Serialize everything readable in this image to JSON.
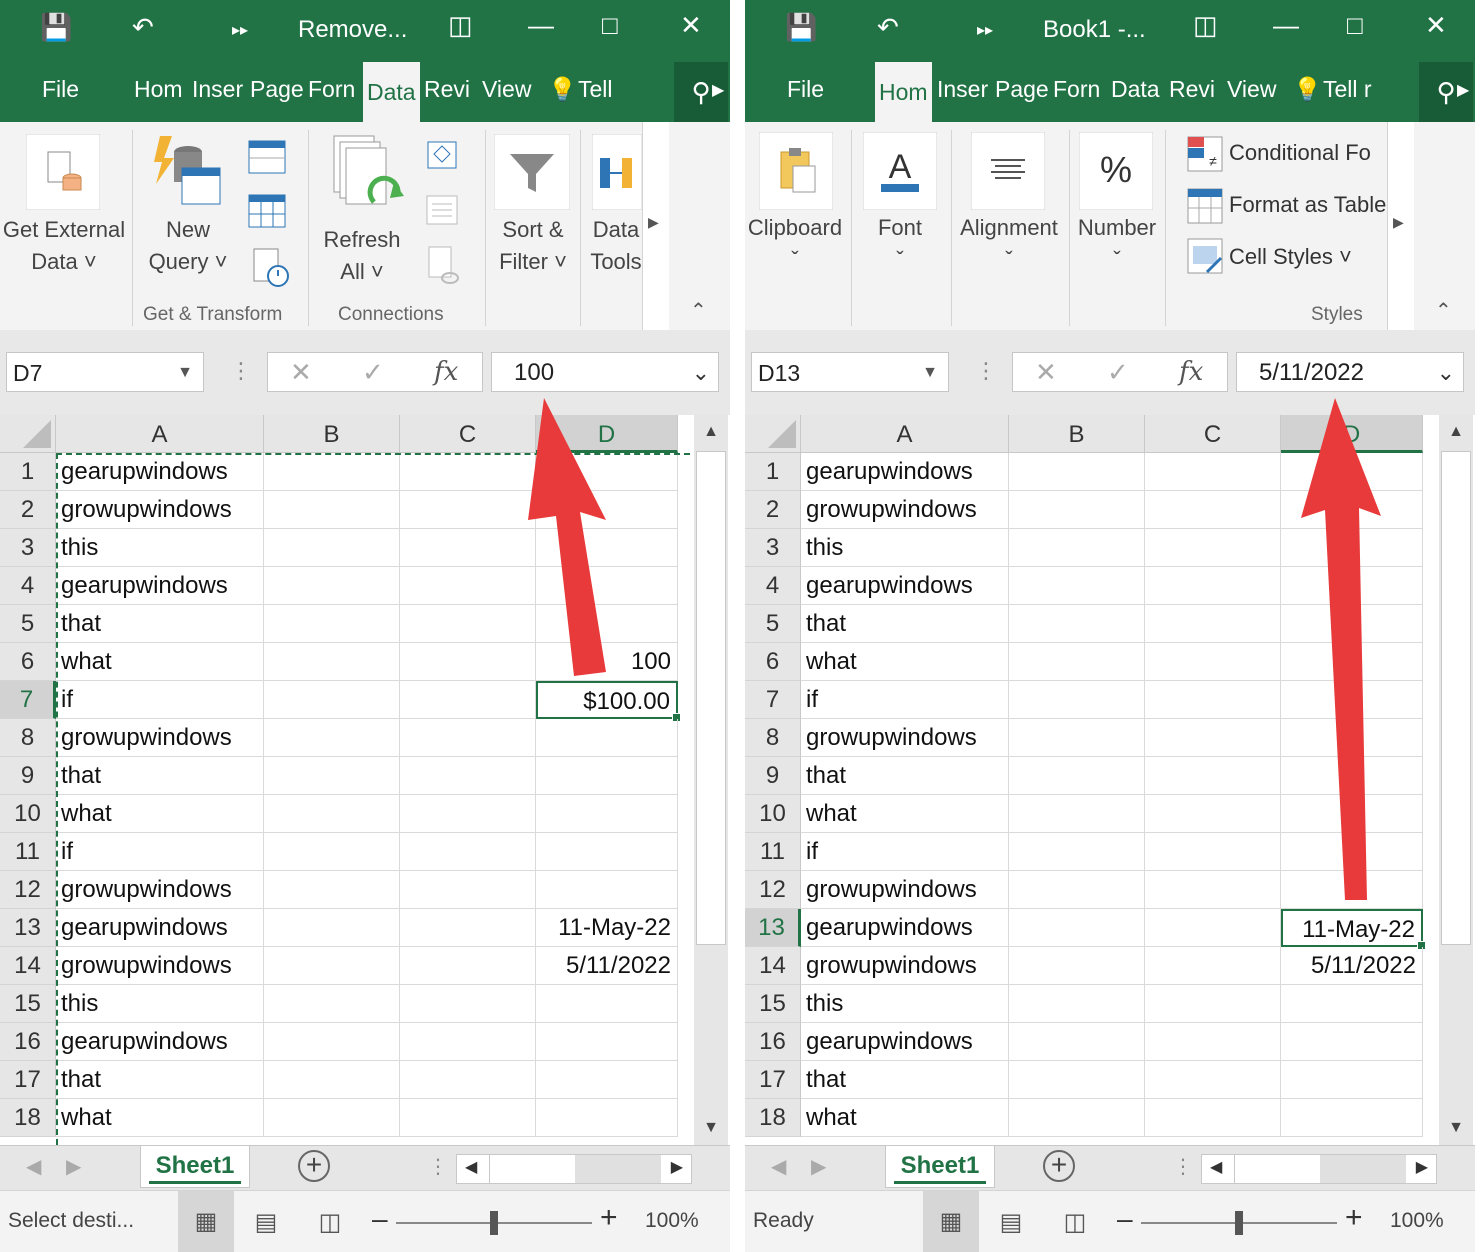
{
  "left": {
    "title": "Remove...",
    "tabs": [
      "File",
      "Hom",
      "Inser",
      "Page",
      "Forn",
      "Data",
      "Revi",
      "View",
      "Tell"
    ],
    "active_tab": "Data",
    "ribbon": {
      "get_external_data": [
        "Get External",
        "Data ˅"
      ],
      "new_query": [
        "New",
        "Query ˅"
      ],
      "refresh_all": [
        "Refresh",
        "All ˅"
      ],
      "sort_filter": [
        "Sort &",
        "Filter ˅"
      ],
      "data_tools": [
        "Data",
        "Tools"
      ],
      "group_get_transform": "Get & Transform",
      "group_connections": "Connections"
    },
    "name_box": "D7",
    "formula_value": "100",
    "columns": [
      "A",
      "B",
      "C",
      "D"
    ],
    "rows": [
      {
        "n": "1",
        "a": "gearupwindows",
        "d": ""
      },
      {
        "n": "2",
        "a": "growupwindows",
        "d": ""
      },
      {
        "n": "3",
        "a": "this",
        "d": ""
      },
      {
        "n": "4",
        "a": "gearupwindows",
        "d": ""
      },
      {
        "n": "5",
        "a": "that",
        "d": ""
      },
      {
        "n": "6",
        "a": "what",
        "d": "100"
      },
      {
        "n": "7",
        "a": "if",
        "d": "$100.00"
      },
      {
        "n": "8",
        "a": "growupwindows",
        "d": ""
      },
      {
        "n": "9",
        "a": "that",
        "d": ""
      },
      {
        "n": "10",
        "a": "what",
        "d": ""
      },
      {
        "n": "11",
        "a": "if",
        "d": ""
      },
      {
        "n": "12",
        "a": "growupwindows",
        "d": ""
      },
      {
        "n": "13",
        "a": "gearupwindows",
        "d": "11-May-22"
      },
      {
        "n": "14",
        "a": "growupwindows",
        "d": "5/11/2022"
      },
      {
        "n": "15",
        "a": "this",
        "d": ""
      },
      {
        "n": "16",
        "a": "gearupwindows",
        "d": ""
      },
      {
        "n": "17",
        "a": "that",
        "d": ""
      },
      {
        "n": "18",
        "a": "what",
        "d": ""
      }
    ],
    "selected_row": "7",
    "sheet_tab": "Sheet1",
    "status": "Select desti...",
    "zoom": "100%"
  },
  "right": {
    "title": "Book1 -...",
    "tabs": [
      "File",
      "Hom",
      "Inser",
      "Page",
      "Forn",
      "Data",
      "Revi",
      "View",
      "Tell r"
    ],
    "active_tab": "Hom",
    "ribbon": {
      "clipboard": "Clipboard",
      "font": "Font",
      "alignment": "Alignment",
      "number": "Number",
      "conditional": "Conditional Fo",
      "format_table": "Format as Table",
      "cell_styles": "Cell Styles ˅",
      "group_styles": "Styles"
    },
    "name_box": "D13",
    "formula_value": "5/11/2022",
    "columns": [
      "A",
      "B",
      "C",
      "D"
    ],
    "rows": [
      {
        "n": "1",
        "a": "gearupwindows",
        "d": ""
      },
      {
        "n": "2",
        "a": "growupwindows",
        "d": ""
      },
      {
        "n": "3",
        "a": "this",
        "d": ""
      },
      {
        "n": "4",
        "a": "gearupwindows",
        "d": ""
      },
      {
        "n": "5",
        "a": "that",
        "d": ""
      },
      {
        "n": "6",
        "a": "what",
        "d": ""
      },
      {
        "n": "7",
        "a": "if",
        "d": ""
      },
      {
        "n": "8",
        "a": "growupwindows",
        "d": ""
      },
      {
        "n": "9",
        "a": "that",
        "d": ""
      },
      {
        "n": "10",
        "a": "what",
        "d": ""
      },
      {
        "n": "11",
        "a": "if",
        "d": ""
      },
      {
        "n": "12",
        "a": "growupwindows",
        "d": ""
      },
      {
        "n": "13",
        "a": "gearupwindows",
        "d": "11-May-22"
      },
      {
        "n": "14",
        "a": "growupwindows",
        "d": "5/11/2022"
      },
      {
        "n": "15",
        "a": "this",
        "d": ""
      },
      {
        "n": "16",
        "a": "gearupwindows",
        "d": ""
      },
      {
        "n": "17",
        "a": "that",
        "d": ""
      },
      {
        "n": "18",
        "a": "what",
        "d": ""
      }
    ],
    "selected_row": "13",
    "sheet_tab": "Sheet1",
    "status": "Ready",
    "zoom": "100%"
  },
  "colors": {
    "excel_green": "#217346",
    "arrow_red": "#e83a3a"
  }
}
